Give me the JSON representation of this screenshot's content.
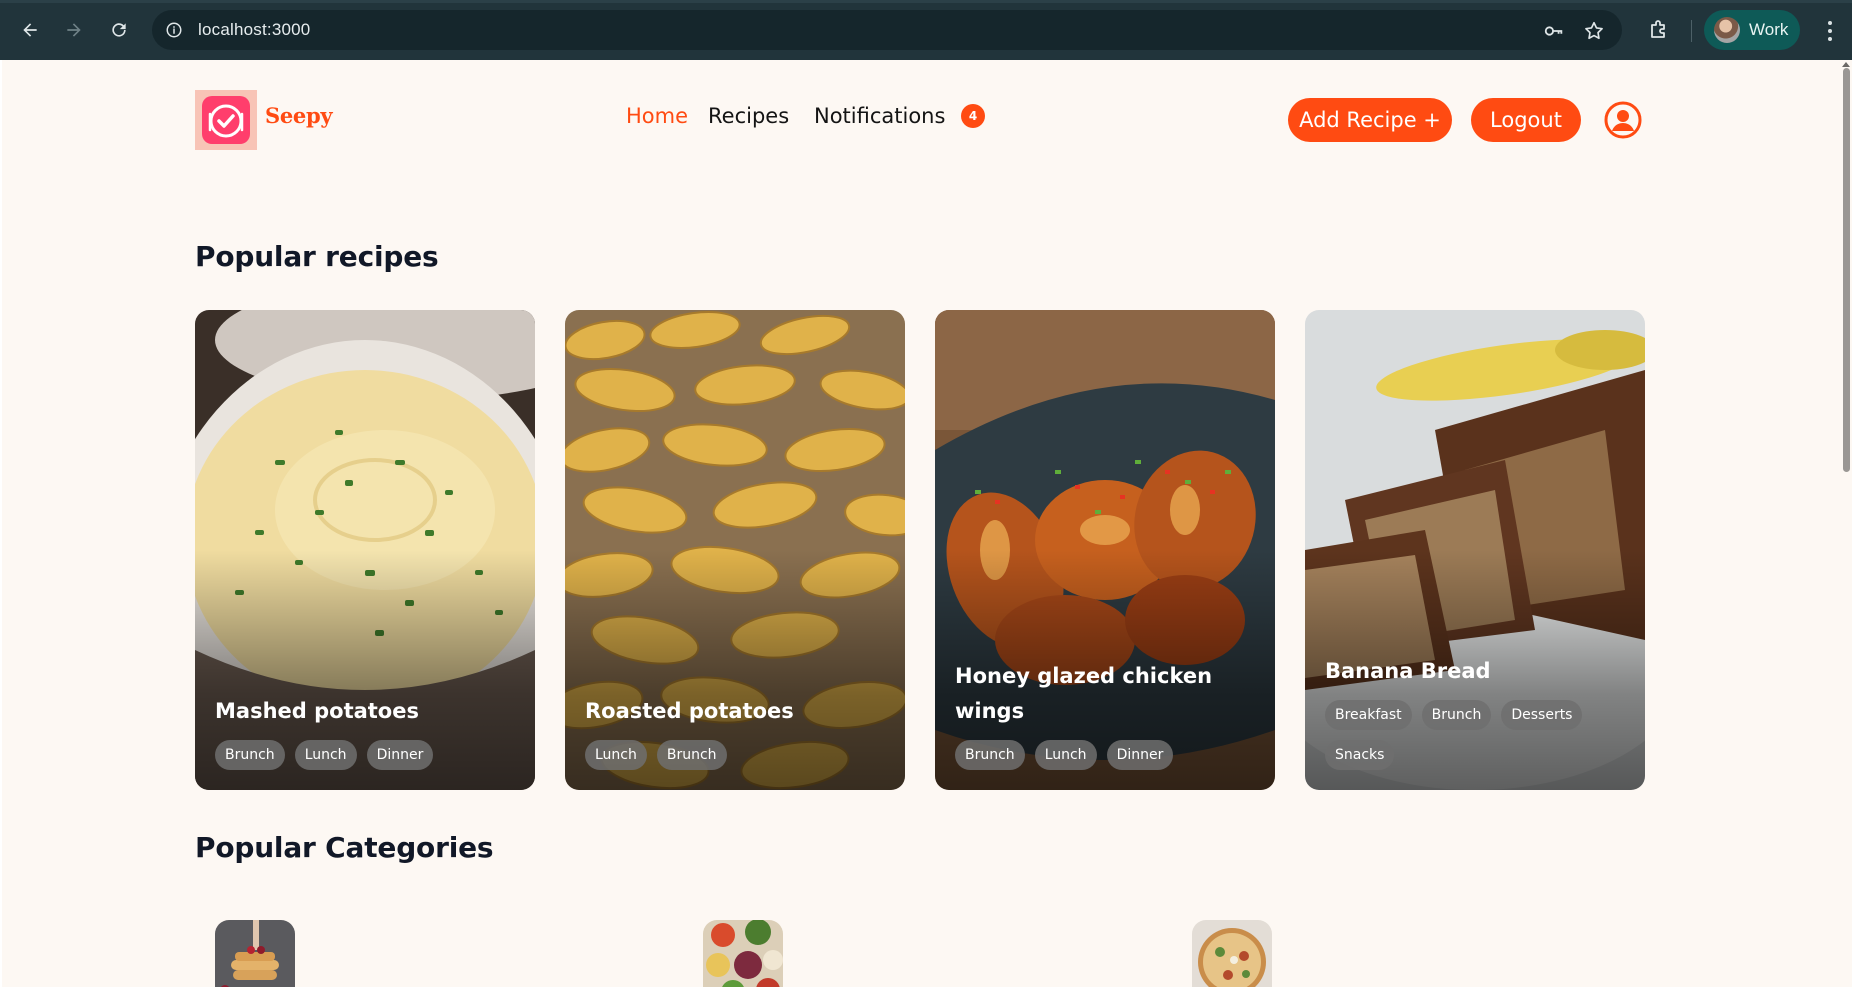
{
  "browser": {
    "url": "localhost:3000",
    "profile_name": "Work",
    "colors": {
      "frame": "#21343b",
      "omnibox": "#15262c",
      "profile": "#0e5a57"
    }
  },
  "site": {
    "brand": "Seepy",
    "nav": [
      {
        "label": "Home",
        "active": true
      },
      {
        "label": "Recipes",
        "active": false
      },
      {
        "label": "Notifications",
        "active": false
      }
    ],
    "notifications_count": "4",
    "add_recipe_label": "Add Recipe +",
    "logout_label": "Logout",
    "accent_color": "#ff4b12",
    "background": "#fdf8f3"
  },
  "popular_recipes": {
    "heading": "Popular recipes",
    "items": [
      {
        "title": "Mashed potatoes",
        "tags": [
          "Brunch",
          "Lunch",
          "Dinner"
        ]
      },
      {
        "title": "Roasted potatoes",
        "tags": [
          "Lunch",
          "Brunch"
        ]
      },
      {
        "title": "Honey glazed chicken wings",
        "tags": [
          "Brunch",
          "Lunch",
          "Dinner"
        ]
      },
      {
        "title": "Banana Bread",
        "tags": [
          "Breakfast",
          "Brunch",
          "Desserts",
          "Snacks"
        ]
      }
    ]
  },
  "popular_categories": {
    "heading": "Popular Categories"
  }
}
